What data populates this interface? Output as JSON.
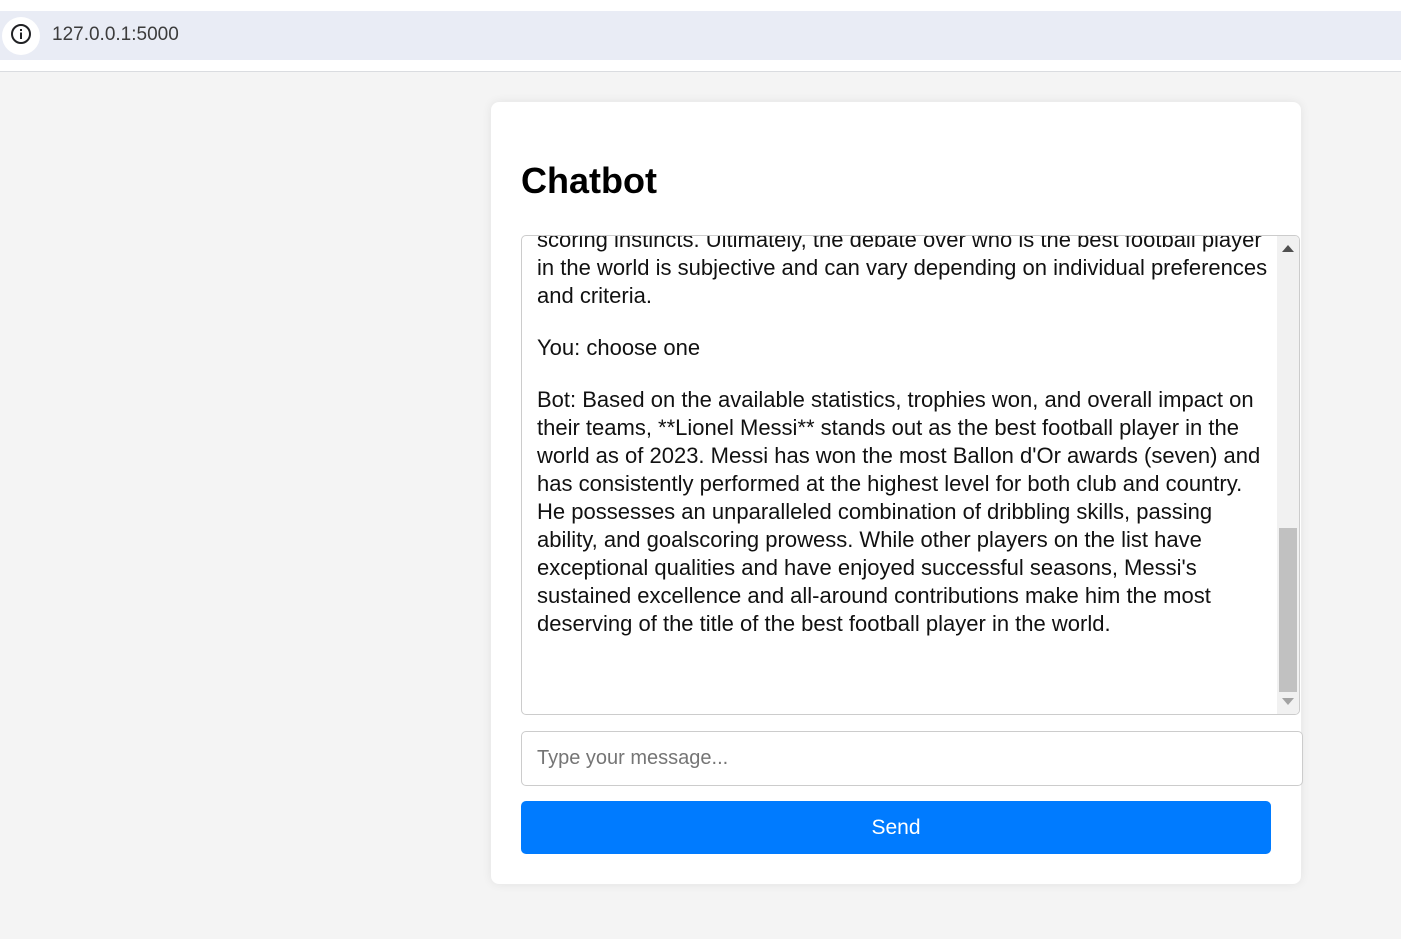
{
  "browser": {
    "url": "127.0.0.1:5000",
    "site_info_icon": "info-icon"
  },
  "page": {
    "title": "Chatbot"
  },
  "chat": {
    "messages": [
      "scoring instincts. Ultimately, the debate over who is the best football player in the world is subjective and can vary depending on individual preferences and criteria.",
      "You: choose one",
      "Bot: Based on the available statistics, trophies won, and overall impact on their teams, **Lionel Messi** stands out as the best football player in the world as of 2023. Messi has won the most Ballon d'Or awards (seven) and has consistently performed at the highest level for both club and country. He possesses an unparalleled combination of dribbling skills, passing ability, and goalscoring prowess. While other players on the list have exceptional qualities and have enjoyed successful seasons, Messi's sustained excellence and all-around contributions make him the most deserving of the title of the best football player in the world."
    ]
  },
  "input": {
    "placeholder": "Type your message...",
    "value": ""
  },
  "send_button": {
    "label": "Send"
  },
  "colors": {
    "accent": "#007bff",
    "page_background": "#f4f4f4",
    "address_bar": "#e9ecf5"
  }
}
